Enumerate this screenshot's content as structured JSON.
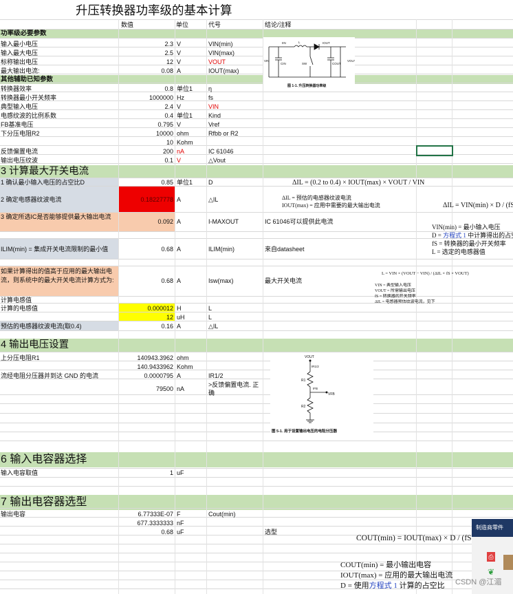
{
  "title": "升压转换器功率级的基本计算",
  "headers": {
    "value": "数值",
    "unit": "单位",
    "code": "代号",
    "note": "结论/注释"
  },
  "sections": {
    "s1": "功率级必要参数",
    "s2": "其他辅助已知参数",
    "s3": "3 计算最大开关电流",
    "s4": "4 输出电压设置",
    "s6": "6 输入电容器选择",
    "s7": "7 输出电容器选型"
  },
  "rows": [
    {
      "label": "输入最小电压",
      "value": "2.3",
      "unit": "V",
      "code": "VIN(min)",
      "note": ""
    },
    {
      "label": "输入最大电压",
      "value": "2.5",
      "unit": "V",
      "code": "VIN(max)",
      "note": ""
    },
    {
      "label": "标称输出电压",
      "value": "12",
      "unit": "V",
      "code": "VOUT",
      "note": ""
    },
    {
      "label": "最大输出电流:",
      "value": "0.08",
      "unit": "A",
      "code": "IOUT(max)",
      "note": ""
    },
    {
      "label": "转换器效率",
      "value": "0.8",
      "unit": "单位1",
      "code": "η",
      "note": ""
    },
    {
      "label": "转换器最小开关频率",
      "value": "1000000",
      "unit": "Hz",
      "code": "fs",
      "note": ""
    },
    {
      "label": "典型输入电压",
      "value": "2.4",
      "unit": "V",
      "code": "VIN",
      "note": ""
    },
    {
      "label": "电感纹波的比例系数",
      "value": "0.4",
      "unit": "单位1",
      "code": "Kind",
      "note": ""
    },
    {
      "label": "FB基准电压",
      "value": "0.795",
      "unit": "V",
      "code": "Vref",
      "note": ""
    },
    {
      "label": "下分压电阻R2",
      "value": "10000",
      "unit": "ohm",
      "code": "Rfbb or R2",
      "note": ""
    },
    {
      "label": "",
      "value": "10",
      "unit": "Kohm",
      "code": "",
      "note": ""
    },
    {
      "label": "反馈偏置电流",
      "value": "200",
      "unit": "nA",
      "code": "IC 61046",
      "note": ""
    },
    {
      "label": "输出电压纹波",
      "value": "0.1",
      "unit": "V",
      "code": "△Vout",
      "note": ""
    },
    {
      "label": "1 确认最小输入电压的占空比D",
      "value": "0.85",
      "unit": "单位1",
      "code": "D",
      "note": ""
    },
    {
      "label": "2 确定电感器纹波电流",
      "value": "0.18227778",
      "unit": "A",
      "code": "△IL",
      "note": ""
    },
    {
      "label": "3 确定所选IC是否能够提供最大输出电流",
      "value": "0.092",
      "unit": "A",
      "code": "I-MAXOUT",
      "note": "IC 61046可以提供此电流"
    },
    {
      "label": "ILIM(min) = 集成开关电流限制的最小值",
      "value": "0.68",
      "unit": "A",
      "code": "ILIM(min)",
      "note": "来自datasheet"
    },
    {
      "label": "如果计算得出的值高于应用的最大输出电流，则系统中的最大开关电流计算方式为:",
      "value": "0.68",
      "unit": "A",
      "code": "Isw(max)",
      "note": "最大开关电流"
    },
    {
      "label": "计算电感值",
      "value": "",
      "unit": "",
      "code": "",
      "note": ""
    },
    {
      "label": "计算的电感值",
      "value": "0.000012",
      "unit": "H",
      "code": "L",
      "note": ""
    },
    {
      "label": "",
      "value": "12",
      "unit": "uH",
      "code": "L",
      "note": ""
    },
    {
      "label": "预估的电感器纹波电流(取0.4)",
      "value": "0.16",
      "unit": "A",
      "code": "△IL",
      "note": ""
    },
    {
      "label": "上分压电阻R1",
      "value": "140943.3962",
      "unit": "ohm",
      "code": "",
      "note": ""
    },
    {
      "label": "",
      "value": "140.9433962",
      "unit": "Kohm",
      "code": "",
      "note": ""
    },
    {
      "label": "流经电阻分压器并到达 GND 的电流",
      "value": "0.0000795",
      "unit": "A",
      "code": "IR1/2",
      "note": ""
    },
    {
      "label": "",
      "value": "79500",
      "unit": "nA",
      "code": ">反馈偏置电流. 正确",
      "note": ""
    },
    {
      "label": "输入电容取值",
      "value": "1",
      "unit": "uF",
      "code": "",
      "note": ""
    },
    {
      "label": "输出电容",
      "value": "6.77333E-07",
      "unit": "F",
      "code": "Cout(min)",
      "note": ""
    },
    {
      "label": "",
      "value": "677.3333333",
      "unit": "nF",
      "code": "",
      "note": ""
    },
    {
      "label": "",
      "value": "0.68",
      "unit": "uF",
      "code": "",
      "note": "选型"
    }
  ],
  "figures": {
    "fig1_caption": "图 1-1. 升压转换器功率级",
    "fig5_caption": "图 5-1. 用于设置输出电压的电阻分压器"
  },
  "formulas": {
    "f1": "ΔIL = (0.2 to 0.4) × IOUT(max) × VOUT / VIN",
    "f1_n1": "ΔIL = 预估的电感器纹波电流",
    "f1_n2": "IOUT(max) = 应用中需要的最大输出电流",
    "f2": "ΔIL = VIN(min) × D / (fS × L)",
    "f2_n1": "VIN(min) = 最小输入电压",
    "f2_n2_a": "D = ",
    "f2_n2_b": "方程式 1",
    "f2_n2_c": " 中计算得出的占空",
    "f2_n3": "fS = 转换器的最小开关频率",
    "f2_n4": "L = 选定的电感器值",
    "f3": "L = VIN × (VOUT − VIN) / (ΔIL × fS × VOUT)",
    "f3_n1": "VIN = 典型输入电压",
    "f3_n2": "VOUT = 所需输出电压",
    "f3_n3": "fS = 转换器的开关频率",
    "f3_n4": "ΔIL = 电感器预估纹波电流，见下",
    "f4": "COUT(min) = IOUT(max) × D / (fS × ΔVOUT)",
    "f4_n1": "COUT(min) = 最小输出电容",
    "f4_n2": "IOUT(max) = 应用的最大输出电流",
    "f4_n3_a": "D = 使用",
    "f4_n3_b": "方程式 1",
    "f4_n3_c": " 计算的占空比"
  },
  "side_panel": {
    "label": "制造商零件"
  },
  "watermark": "CSDN @江湄"
}
